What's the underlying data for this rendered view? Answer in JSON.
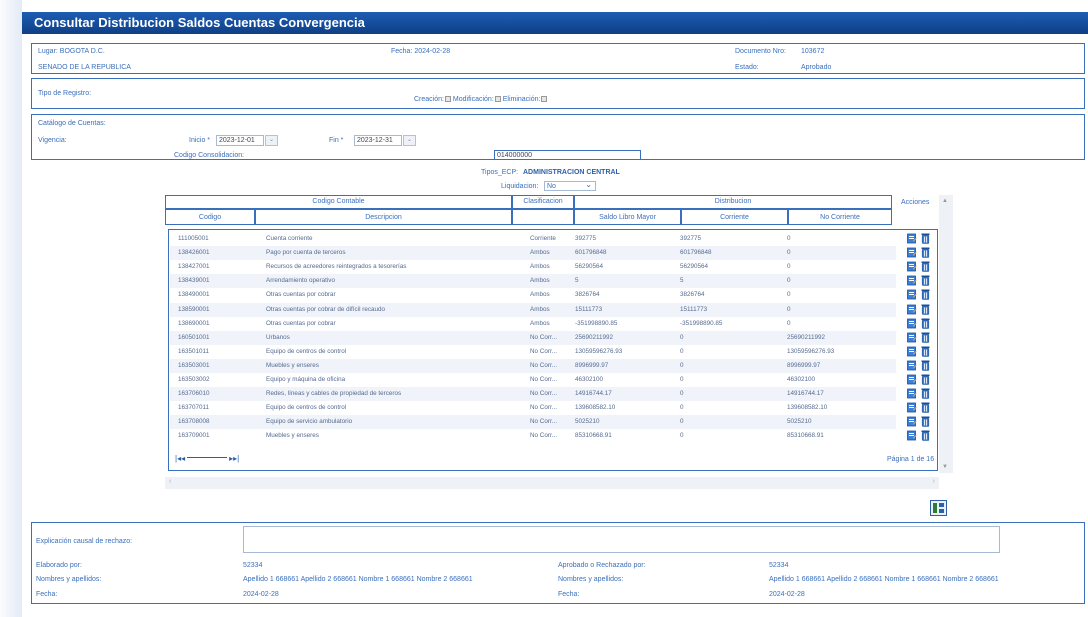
{
  "title": "Consultar Distribucion Saldos Cuentas Convergencia",
  "header": {
    "lugar": "Lugar: BOGOTA D.C.",
    "entidad": "SENADO DE LA REPUBLICA",
    "fecha": "Fecha: 2024-02-28",
    "documento_label": "Documento Nro:",
    "documento_value": "103672",
    "estado_label": "Estado:",
    "estado_value": "Aprobado"
  },
  "tipo_registro": {
    "label": "Tipo de Registro:",
    "creacion": "Creación:",
    "modificacion": "Modificación:",
    "eliminacion": "Eliminación:"
  },
  "catalogo": {
    "label": "Catálogo de Cuentas:",
    "vigencia_label": "Vigencia:",
    "inicio_label": "Inicio *",
    "inicio_value": "2023-12-01",
    "fin_label": "Fin *",
    "fin_value": "2023-12-31",
    "codigo_label": "Codigo Consolidacion:",
    "codigo_value": "014000000"
  },
  "tipos_ecp": {
    "label": "Tipos_ECP:",
    "value": "ADMINISTRACION CENTRAL"
  },
  "liquidacion": {
    "label": "Liquidacion:",
    "value": "No"
  },
  "grid": {
    "group_headers": {
      "codigo_contable": "Codigo Contable",
      "clasificacion": "Clasificacion",
      "distribucion": "Distribucion",
      "acciones": "Acciones"
    },
    "columns": {
      "codigo": "Codigo",
      "descripcion": "Descripcion",
      "saldo": "Saldo Libro Mayor",
      "corriente": "Corriente",
      "no_corriente": "No Corriente"
    },
    "rows": [
      {
        "codigo": "111005001",
        "descripcion": "Cuenta corriente",
        "clasificacion": "Corriente",
        "saldo": "392775",
        "corriente": "392775",
        "no_corriente": "0"
      },
      {
        "codigo": "138426001",
        "descripcion": "Pago por cuenta de terceros",
        "clasificacion": "Ambos",
        "saldo": "601796848",
        "corriente": "601796848",
        "no_corriente": "0"
      },
      {
        "codigo": "138427001",
        "descripcion": "Recursos de acreedores reintegrados a tesorerías",
        "clasificacion": "Ambos",
        "saldo": "56290564",
        "corriente": "56290564",
        "no_corriente": "0"
      },
      {
        "codigo": "138439001",
        "descripcion": "Arrendamiento operativo",
        "clasificacion": "Ambos",
        "saldo": "5",
        "corriente": "5",
        "no_corriente": "0"
      },
      {
        "codigo": "138490001",
        "descripcion": "Otras cuentas por cobrar",
        "clasificacion": "Ambos",
        "saldo": "3826764",
        "corriente": "3826764",
        "no_corriente": "0"
      },
      {
        "codigo": "138590001",
        "descripcion": "Otras cuentas por cobrar de difícil recaudo",
        "clasificacion": "Ambos",
        "saldo": "15111773",
        "corriente": "15111773",
        "no_corriente": "0"
      },
      {
        "codigo": "138690001",
        "descripcion": "Otras cuentas por cobrar",
        "clasificacion": "Ambos",
        "saldo": "-351998890.85",
        "corriente": "-351998890.85",
        "no_corriente": "0"
      },
      {
        "codigo": "160501001",
        "descripcion": "Urbanos",
        "clasificacion": "No Corr...",
        "saldo": "25690211992",
        "corriente": "0",
        "no_corriente": "25690211992"
      },
      {
        "codigo": "163501011",
        "descripcion": "Equipo de centros de control",
        "clasificacion": "No Corr...",
        "saldo": "13059596276.93",
        "corriente": "0",
        "no_corriente": "13059596276.93"
      },
      {
        "codigo": "163503001",
        "descripcion": "Muebles y enseres",
        "clasificacion": "No Corr...",
        "saldo": "8996999.97",
        "corriente": "0",
        "no_corriente": "8996999.97"
      },
      {
        "codigo": "163503002",
        "descripcion": "Equipo y máquina de oficina",
        "clasificacion": "No Corr...",
        "saldo": "46302100",
        "corriente": "0",
        "no_corriente": "46302100"
      },
      {
        "codigo": "163706010",
        "descripcion": "Redes, líneas y cables de propiedad de terceros",
        "clasificacion": "No Corr...",
        "saldo": "14916744.17",
        "corriente": "0",
        "no_corriente": "14916744.17"
      },
      {
        "codigo": "163707011",
        "descripcion": "Equipo de centros de control",
        "clasificacion": "No Corr...",
        "saldo": "139608582.10",
        "corriente": "0",
        "no_corriente": "139608582.10"
      },
      {
        "codigo": "163708008",
        "descripcion": "Equipo de servicio ambulatorio",
        "clasificacion": "No Corr...",
        "saldo": "5025210",
        "corriente": "0",
        "no_corriente": "5025210"
      },
      {
        "codigo": "163709001",
        "descripcion": "Muebles y enseres",
        "clasificacion": "No Corr...",
        "saldo": "85310668.91",
        "corriente": "0",
        "no_corriente": "85310668.91"
      }
    ],
    "pager": "Página 1 de 16"
  },
  "footer": {
    "rechazo_label": "Explicación causal de rechazo:",
    "rechazo_value": "",
    "elaborado_label": "Elaborado por:",
    "elaborado_value": "52334",
    "aprobado_label": "Aprobado o Rechazado por:",
    "aprobado_value": "52334",
    "nombres_label": "Nombres y apellidos:",
    "nombres_value": "Apellido 1 668661 Apellido 2 668661 Nombre 1 668661 Nombre 2 668661",
    "nombres2_label": "Nombres y apellidos:",
    "nombres2_value": "Apellido 1 668661 Apellido 2 668661 Nombre 1 668661 Nombre 2 668661",
    "fecha_label": "Fecha:",
    "fecha_value": "2024-02-28",
    "fecha2_label": "Fecha:",
    "fecha2_value": "2024-02-28"
  },
  "icons": {
    "edit": "edit-icon",
    "delete": "trash-icon",
    "export": "export-excel-icon"
  }
}
